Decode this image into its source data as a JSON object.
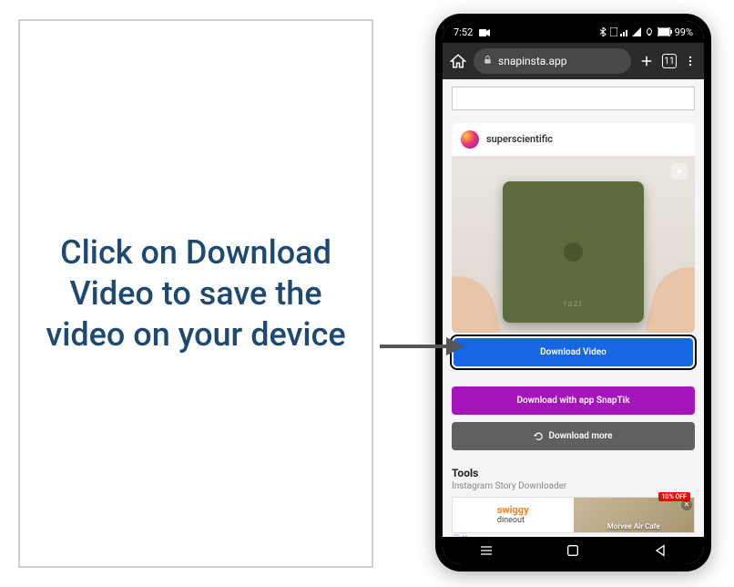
{
  "instruction": {
    "text": "Click on Download Video to save the video on your device"
  },
  "status": {
    "time": "7:52",
    "battery": "99%"
  },
  "browser": {
    "url": "snapinsta.app"
  },
  "card": {
    "username": "superscientific",
    "device_brand": "razr"
  },
  "buttons": {
    "download_video": "Download Video",
    "snaptik": "Download with app SnapTik",
    "more": "Download more"
  },
  "tools": {
    "heading": "Tools",
    "link": "Instagram Story Downloader"
  },
  "ad": {
    "brand": "swiggy",
    "subbrand": "dineout",
    "discount": "10% OFF",
    "venue": "Morvee Air Cafe",
    "info_icon": "ⓘ ✕"
  },
  "colors": {
    "download_btn": "#1666e5",
    "snaptik_btn": "#a614bb",
    "more_btn": "#606060",
    "instruction_text": "#1e4a72"
  }
}
